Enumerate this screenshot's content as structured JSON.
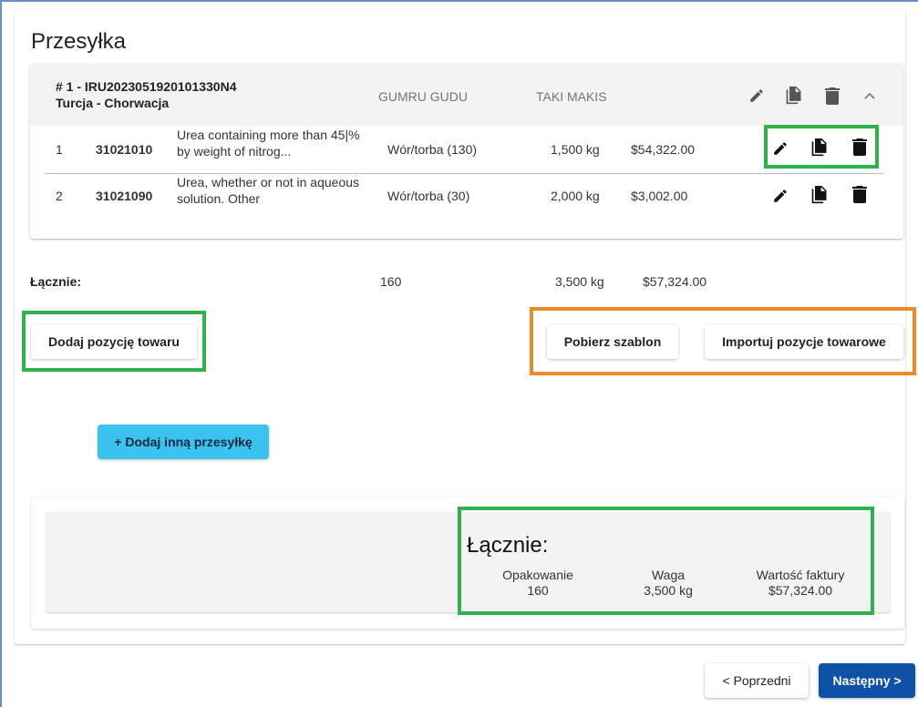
{
  "page": {
    "title": "Przesyłka"
  },
  "shipment": {
    "id": "# 1 - IRU2023051920101330N4",
    "route": "Turcja - Chorwacja",
    "col_package": "GUMRU GUDU",
    "col_weight": "TAKI MAKIS",
    "items": [
      {
        "num": "1",
        "code": "31021010",
        "desc_line1": "Urea containing more than 45|%",
        "desc_line2": "by weight of nitrog...",
        "package": "Wór/torba (130)",
        "weight": "1,500 kg",
        "value": "$54,322.00"
      },
      {
        "num": "2",
        "code": "31021090",
        "desc_line1": "Urea, whether or not in aqueous",
        "desc_line2": "solution. Other",
        "package": "Wór/torba (30)",
        "weight": "2,000 kg",
        "value": "$3,002.00"
      }
    ]
  },
  "totals": {
    "label": "Łącznie:",
    "packages": "160",
    "weight": "3,500 kg",
    "value": "$57,324.00"
  },
  "buttons": {
    "add_item": "Dodaj pozycję towaru",
    "download_template": "Pobierz szablon",
    "import_items": "Importuj pozycje towarowe",
    "add_shipment": "+ Dodaj inną przesyłkę",
    "previous": "< Poprzedni",
    "next": "Następny >"
  },
  "summary": {
    "title": "Łącznie:",
    "packaging_label": "Opakowanie",
    "packaging_value": "160",
    "weight_label": "Waga",
    "weight_value": "3,500 kg",
    "invoice_label": "Wartość faktury",
    "invoice_value": "$57,324.00"
  },
  "colors": {
    "highlight_green": "#2db34a",
    "highlight_orange": "#f28a24",
    "primary_blue": "#0d52a6",
    "accent_cyan": "#3cc2ee"
  },
  "icons": {
    "edit": "pencil-icon",
    "copy": "copy-icon",
    "delete": "trash-icon",
    "collapse": "chevron-up-icon"
  }
}
